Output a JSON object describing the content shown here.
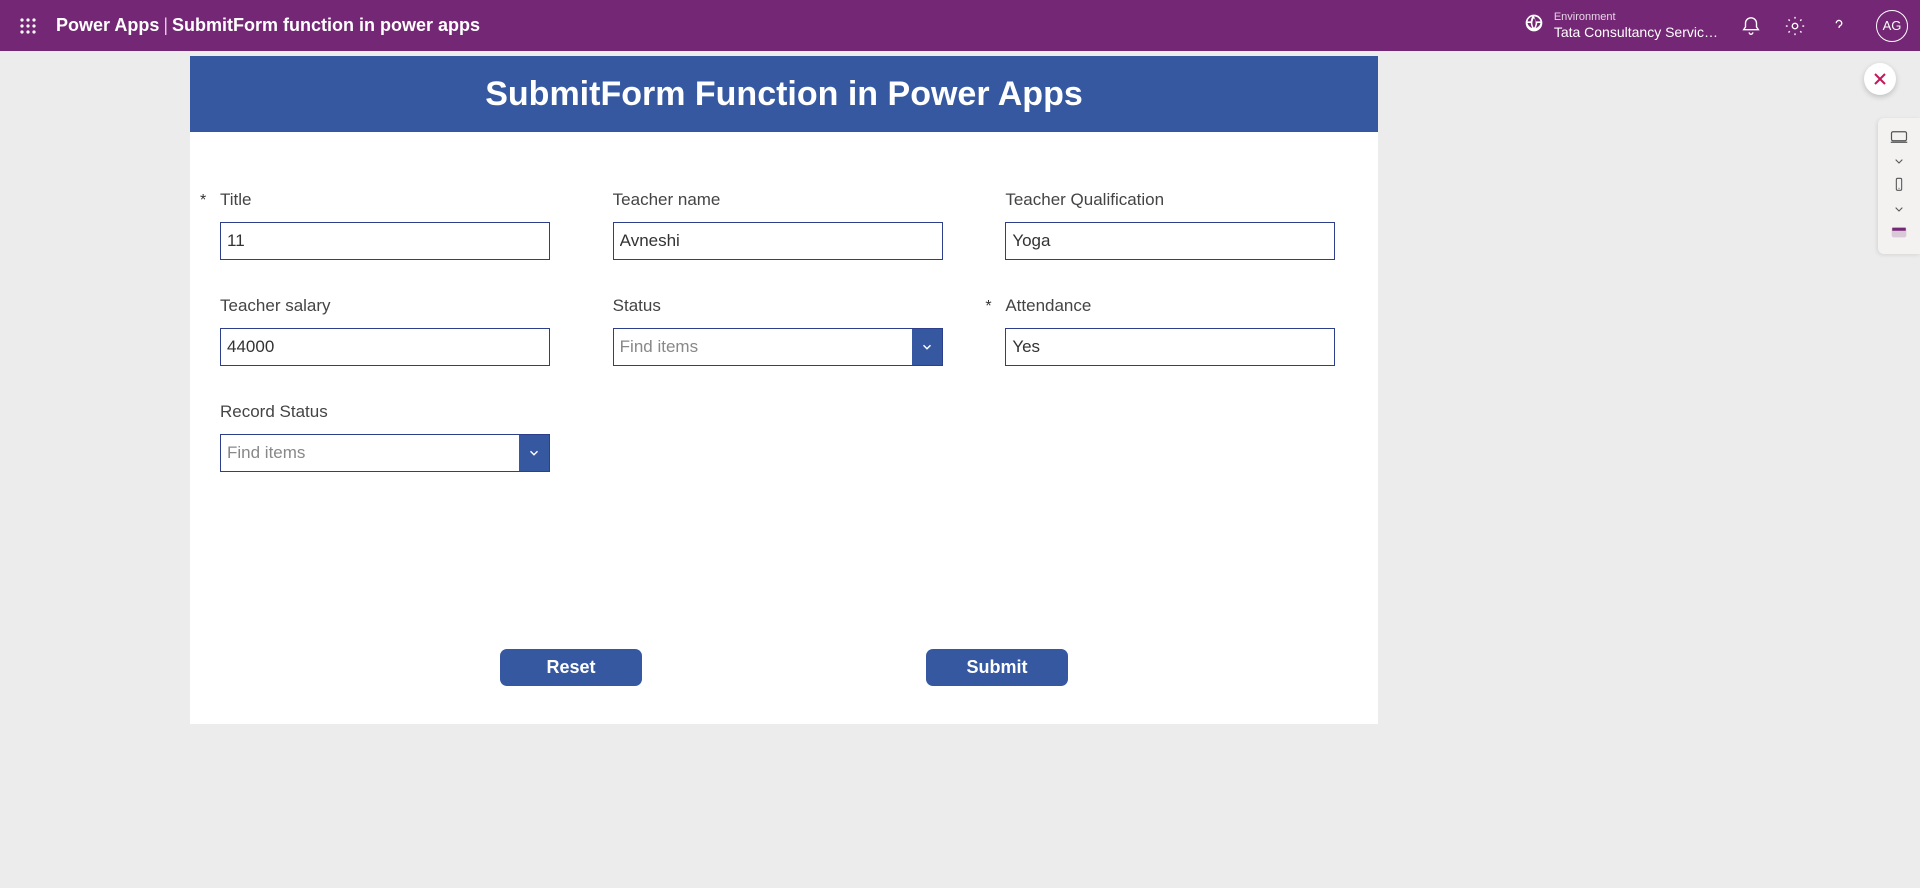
{
  "header": {
    "brand": "Power Apps",
    "separator": "|",
    "app_name": "SubmitForm function in power apps",
    "environment_label": "Environment",
    "environment_name": "Tata Consultancy Servic…",
    "avatar_initials": "AG"
  },
  "canvas": {
    "title": "SubmitForm Function in Power Apps"
  },
  "form": {
    "title": {
      "label": "Title",
      "required": true,
      "value": "11"
    },
    "teacher_name": {
      "label": "Teacher name",
      "required": false,
      "value": "Avneshi"
    },
    "teacher_qualification": {
      "label": "Teacher Qualification",
      "required": false,
      "value": "Yoga"
    },
    "teacher_salary": {
      "label": "Teacher salary",
      "required": false,
      "value": "44000"
    },
    "status": {
      "label": "Status",
      "required": false,
      "placeholder": "Find items",
      "value": ""
    },
    "attendance": {
      "label": "Attendance",
      "required": true,
      "value": "Yes"
    },
    "record_status": {
      "label": "Record Status",
      "required": false,
      "placeholder": "Find items",
      "value": ""
    }
  },
  "buttons": {
    "reset": "Reset",
    "submit": "Submit"
  }
}
